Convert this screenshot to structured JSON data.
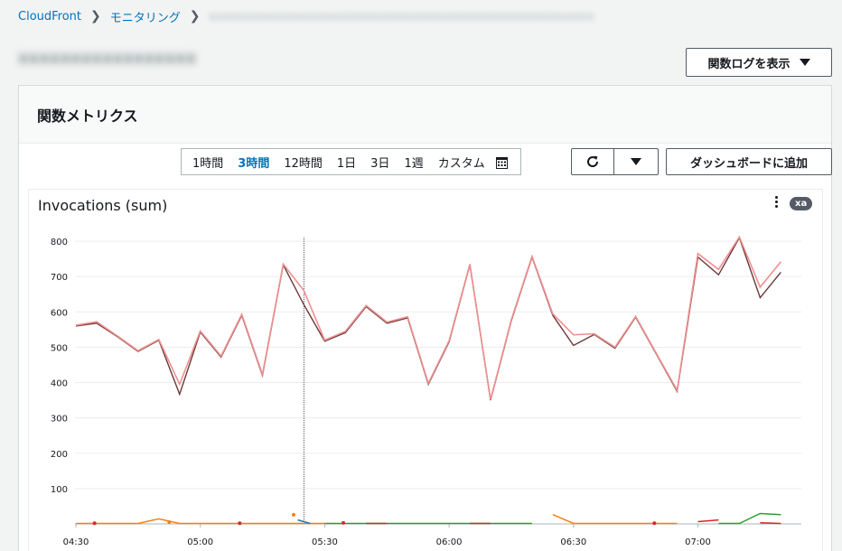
{
  "breadcrumb": {
    "items": [
      "CloudFront",
      "モニタリング"
    ]
  },
  "header_actions": {
    "view_logs_label": "関数ログを表示"
  },
  "panel": {
    "title": "関数メトリクス"
  },
  "time_range": {
    "options": [
      "1時間",
      "3時間",
      "12時間",
      "1日",
      "3日",
      "1週",
      "カスタム"
    ],
    "selected": "3時間"
  },
  "toolbar": {
    "add_to_dashboard_label": "ダッシュボードに追加"
  },
  "widget": {
    "title": "Invocations (sum)",
    "badge": "xa"
  },
  "colors": {
    "link": "#0073bb",
    "series_dark": "#6b3a3a",
    "series_light": "#f08f8f",
    "orange": "#ff7f0e",
    "green": "#2ca02c",
    "red": "#d62728",
    "blue": "#1f77b4"
  },
  "chart_data": {
    "type": "line",
    "ylim": [
      0,
      800
    ],
    "yticks": [
      100,
      200,
      300,
      400,
      500,
      600,
      700,
      800
    ],
    "xtick_labels": [
      "04:30",
      "05:00",
      "05:30",
      "06:00",
      "06:30",
      "07:00"
    ],
    "x_start": "04:30",
    "x_step_minutes": 5,
    "cursor_time": "05:25",
    "series": [
      {
        "color": "#6b3a3a",
        "values": [
          560,
          568,
          530,
          488,
          520,
          367,
          543,
          472,
          590,
          420,
          733,
          620,
          517,
          541,
          615,
          568,
          583,
          395,
          515,
          733,
          350,
          575,
          755,
          590,
          505,
          536,
          497,
          585,
          480,
          375,
          755,
          705,
          810,
          640,
          712
        ]
      },
      {
        "color": "#f08f8f",
        "values": [
          562,
          572,
          532,
          490,
          522,
          395,
          546,
          475,
          593,
          423,
          735,
          660,
          520,
          545,
          618,
          571,
          586,
          398,
          518,
          735,
          352,
          578,
          757,
          594,
          535,
          538,
          500,
          587,
          482,
          378,
          765,
          720,
          812,
          670,
          742
        ]
      }
    ],
    "minor_series": [
      {
        "color": "#ff7f0e",
        "points": [
          [
            0,
            0
          ],
          [
            1,
            0
          ],
          [
            2,
            0
          ],
          [
            3,
            0
          ],
          [
            4,
            13
          ],
          [
            5,
            0
          ],
          [
            6,
            0
          ],
          [
            7,
            0
          ],
          [
            8,
            0
          ],
          [
            9,
            0
          ],
          [
            10,
            0
          ],
          [
            11,
            0
          ],
          [
            12,
            0
          ]
        ]
      },
      {
        "color": "#2ca02c",
        "points": [
          [
            12,
            0
          ],
          [
            13,
            0
          ],
          [
            14,
            0
          ],
          [
            15,
            0
          ],
          [
            16,
            0
          ],
          [
            17,
            0
          ],
          [
            18,
            0
          ],
          [
            19,
            0
          ],
          [
            20,
            0
          ],
          [
            21,
            0
          ],
          [
            22,
            0
          ]
        ]
      },
      {
        "color": "#d62728",
        "points": [
          [
            14,
            0
          ],
          [
            15,
            0
          ]
        ]
      },
      {
        "color": "#d62728",
        "points": [
          [
            19,
            0
          ],
          [
            20,
            0
          ]
        ]
      },
      {
        "color": "#ff7f0e",
        "points": [
          [
            23,
            25
          ],
          [
            24,
            0
          ],
          [
            25,
            0
          ],
          [
            26,
            0
          ],
          [
            27,
            0
          ],
          [
            28,
            0
          ],
          [
            29,
            0
          ]
        ]
      },
      {
        "color": "#d62728",
        "points": [
          [
            30,
            5
          ],
          [
            31,
            10
          ]
        ]
      },
      {
        "color": "#2ca02c",
        "points": [
          [
            31,
            0
          ],
          [
            32,
            0
          ],
          [
            33,
            28
          ],
          [
            34,
            25
          ]
        ]
      },
      {
        "color": "#d62728",
        "points": [
          [
            33,
            2
          ],
          [
            34,
            0
          ]
        ]
      },
      {
        "color": "#1f77b4",
        "points": [
          [
            10.7,
            10
          ],
          [
            11.3,
            0
          ]
        ]
      }
    ],
    "markers": [
      {
        "color": "#d62728",
        "x": 0.9,
        "y": 2
      },
      {
        "color": "#ff7f0e",
        "x": 4.5,
        "y": 5
      },
      {
        "color": "#d62728",
        "x": 7.9,
        "y": 2
      },
      {
        "color": "#ff7f0e",
        "x": 10.5,
        "y": 26
      },
      {
        "color": "#d62728",
        "x": 12.9,
        "y": 3
      },
      {
        "color": "#d62728",
        "x": 27.9,
        "y": 2
      }
    ]
  }
}
